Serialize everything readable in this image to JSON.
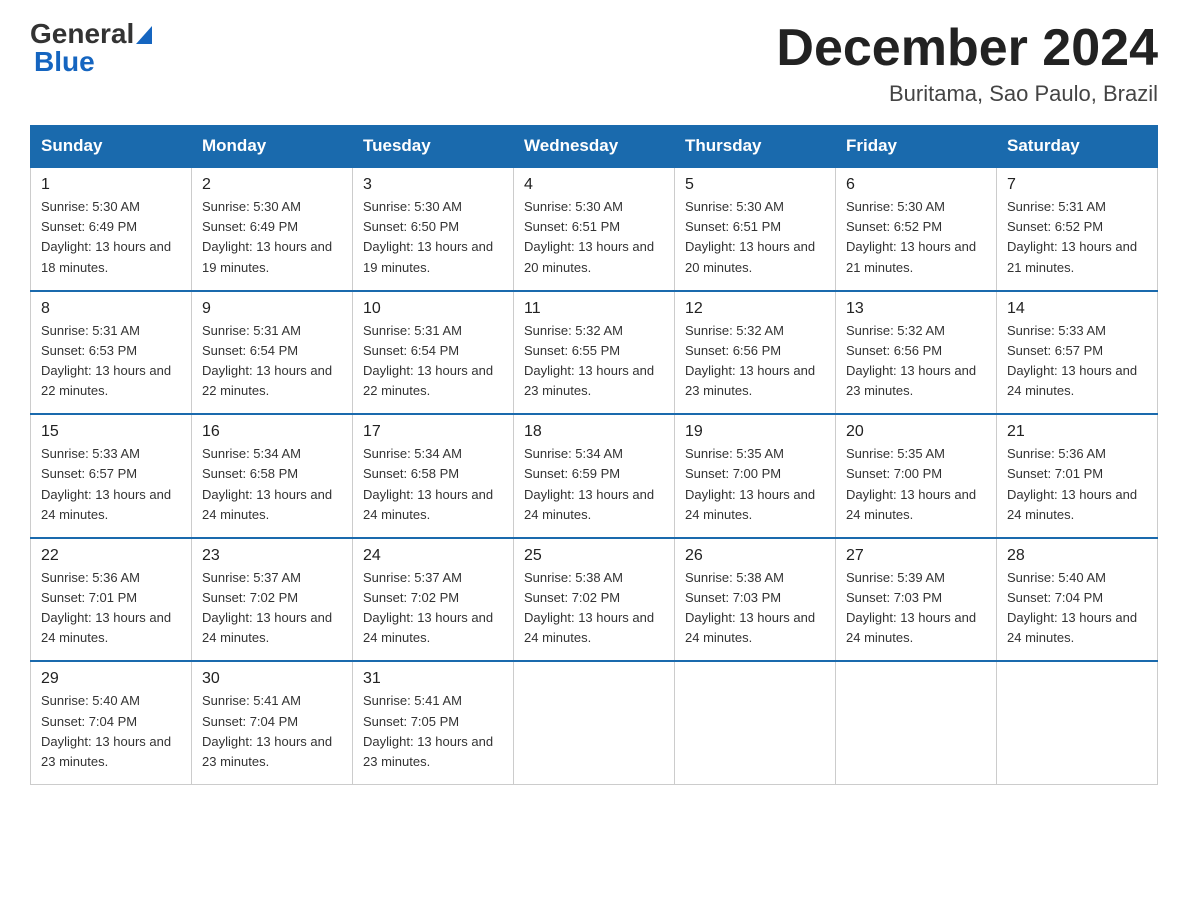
{
  "header": {
    "logo_general": "General",
    "logo_blue": "Blue",
    "title": "December 2024",
    "subtitle": "Buritama, Sao Paulo, Brazil"
  },
  "weekdays": [
    "Sunday",
    "Monday",
    "Tuesday",
    "Wednesday",
    "Thursday",
    "Friday",
    "Saturday"
  ],
  "weeks": [
    [
      {
        "day": "1",
        "sunrise": "5:30 AM",
        "sunset": "6:49 PM",
        "daylight": "13 hours and 18 minutes."
      },
      {
        "day": "2",
        "sunrise": "5:30 AM",
        "sunset": "6:49 PM",
        "daylight": "13 hours and 19 minutes."
      },
      {
        "day": "3",
        "sunrise": "5:30 AM",
        "sunset": "6:50 PM",
        "daylight": "13 hours and 19 minutes."
      },
      {
        "day": "4",
        "sunrise": "5:30 AM",
        "sunset": "6:51 PM",
        "daylight": "13 hours and 20 minutes."
      },
      {
        "day": "5",
        "sunrise": "5:30 AM",
        "sunset": "6:51 PM",
        "daylight": "13 hours and 20 minutes."
      },
      {
        "day": "6",
        "sunrise": "5:30 AM",
        "sunset": "6:52 PM",
        "daylight": "13 hours and 21 minutes."
      },
      {
        "day": "7",
        "sunrise": "5:31 AM",
        "sunset": "6:52 PM",
        "daylight": "13 hours and 21 minutes."
      }
    ],
    [
      {
        "day": "8",
        "sunrise": "5:31 AM",
        "sunset": "6:53 PM",
        "daylight": "13 hours and 22 minutes."
      },
      {
        "day": "9",
        "sunrise": "5:31 AM",
        "sunset": "6:54 PM",
        "daylight": "13 hours and 22 minutes."
      },
      {
        "day": "10",
        "sunrise": "5:31 AM",
        "sunset": "6:54 PM",
        "daylight": "13 hours and 22 minutes."
      },
      {
        "day": "11",
        "sunrise": "5:32 AM",
        "sunset": "6:55 PM",
        "daylight": "13 hours and 23 minutes."
      },
      {
        "day": "12",
        "sunrise": "5:32 AM",
        "sunset": "6:56 PM",
        "daylight": "13 hours and 23 minutes."
      },
      {
        "day": "13",
        "sunrise": "5:32 AM",
        "sunset": "6:56 PM",
        "daylight": "13 hours and 23 minutes."
      },
      {
        "day": "14",
        "sunrise": "5:33 AM",
        "sunset": "6:57 PM",
        "daylight": "13 hours and 24 minutes."
      }
    ],
    [
      {
        "day": "15",
        "sunrise": "5:33 AM",
        "sunset": "6:57 PM",
        "daylight": "13 hours and 24 minutes."
      },
      {
        "day": "16",
        "sunrise": "5:34 AM",
        "sunset": "6:58 PM",
        "daylight": "13 hours and 24 minutes."
      },
      {
        "day": "17",
        "sunrise": "5:34 AM",
        "sunset": "6:58 PM",
        "daylight": "13 hours and 24 minutes."
      },
      {
        "day": "18",
        "sunrise": "5:34 AM",
        "sunset": "6:59 PM",
        "daylight": "13 hours and 24 minutes."
      },
      {
        "day": "19",
        "sunrise": "5:35 AM",
        "sunset": "7:00 PM",
        "daylight": "13 hours and 24 minutes."
      },
      {
        "day": "20",
        "sunrise": "5:35 AM",
        "sunset": "7:00 PM",
        "daylight": "13 hours and 24 minutes."
      },
      {
        "day": "21",
        "sunrise": "5:36 AM",
        "sunset": "7:01 PM",
        "daylight": "13 hours and 24 minutes."
      }
    ],
    [
      {
        "day": "22",
        "sunrise": "5:36 AM",
        "sunset": "7:01 PM",
        "daylight": "13 hours and 24 minutes."
      },
      {
        "day": "23",
        "sunrise": "5:37 AM",
        "sunset": "7:02 PM",
        "daylight": "13 hours and 24 minutes."
      },
      {
        "day": "24",
        "sunrise": "5:37 AM",
        "sunset": "7:02 PM",
        "daylight": "13 hours and 24 minutes."
      },
      {
        "day": "25",
        "sunrise": "5:38 AM",
        "sunset": "7:02 PM",
        "daylight": "13 hours and 24 minutes."
      },
      {
        "day": "26",
        "sunrise": "5:38 AM",
        "sunset": "7:03 PM",
        "daylight": "13 hours and 24 minutes."
      },
      {
        "day": "27",
        "sunrise": "5:39 AM",
        "sunset": "7:03 PM",
        "daylight": "13 hours and 24 minutes."
      },
      {
        "day": "28",
        "sunrise": "5:40 AM",
        "sunset": "7:04 PM",
        "daylight": "13 hours and 24 minutes."
      }
    ],
    [
      {
        "day": "29",
        "sunrise": "5:40 AM",
        "sunset": "7:04 PM",
        "daylight": "13 hours and 23 minutes."
      },
      {
        "day": "30",
        "sunrise": "5:41 AM",
        "sunset": "7:04 PM",
        "daylight": "13 hours and 23 minutes."
      },
      {
        "day": "31",
        "sunrise": "5:41 AM",
        "sunset": "7:05 PM",
        "daylight": "13 hours and 23 minutes."
      },
      null,
      null,
      null,
      null
    ]
  ]
}
